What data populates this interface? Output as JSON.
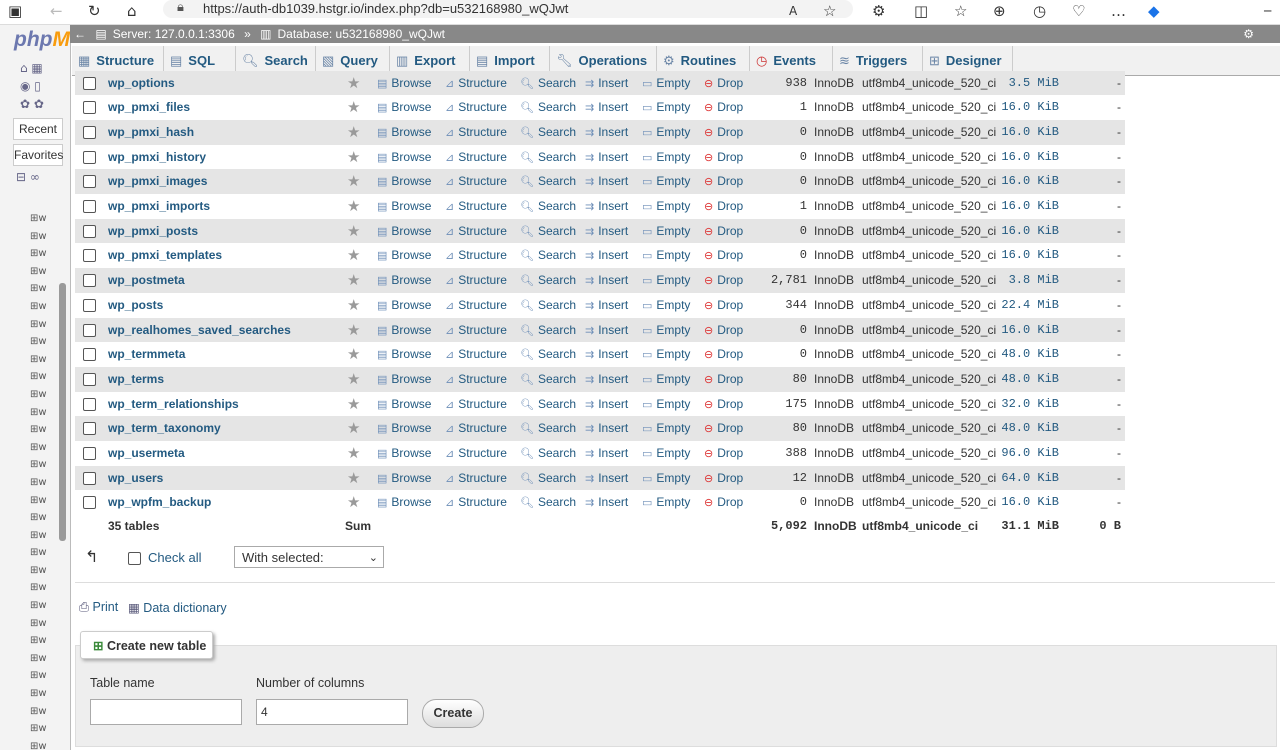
{
  "browser": {
    "url": "https://auth-db1039.hstgr.io/index.php?db=u532168980_wQJwt"
  },
  "breadcrumb": {
    "server": "Server: 127.0.0.1:3306",
    "separator": "»",
    "database": "Database: u532168980_wQJwt"
  },
  "tabs": [
    {
      "label": "Structure",
      "icon": "structure-icon"
    },
    {
      "label": "SQL",
      "icon": "sql-icon"
    },
    {
      "label": "Search",
      "icon": "search-icon"
    },
    {
      "label": "Query",
      "icon": "query-icon"
    },
    {
      "label": "Export",
      "icon": "export-icon"
    },
    {
      "label": "Import",
      "icon": "import-icon"
    },
    {
      "label": "Operations",
      "icon": "wrench-icon"
    },
    {
      "label": "Routines",
      "icon": "routines-icon"
    },
    {
      "label": "Events",
      "icon": "clock-icon"
    },
    {
      "label": "Triggers",
      "icon": "triggers-icon"
    },
    {
      "label": "Designer",
      "icon": "designer-icon"
    }
  ],
  "nav": {
    "logo_a": "php",
    "logo_b": "M",
    "recent": "Recent",
    "favorites": "Favorites",
    "tree_item": "w"
  },
  "actions": {
    "browse": "Browse",
    "structure": "Structure",
    "search": "Search",
    "insert": "Insert",
    "empty": "Empty",
    "drop": "Drop"
  },
  "tables": [
    {
      "name": "wp_options",
      "rows": "938",
      "engine": "InnoDB",
      "collation": "utf8mb4_unicode_520_ci",
      "size": "3.5 MiB",
      "overhead": "-"
    },
    {
      "name": "wp_pmxi_files",
      "rows": "1",
      "engine": "InnoDB",
      "collation": "utf8mb4_unicode_520_ci",
      "size": "16.0 KiB",
      "overhead": "-"
    },
    {
      "name": "wp_pmxi_hash",
      "rows": "0",
      "engine": "InnoDB",
      "collation": "utf8mb4_unicode_520_ci",
      "size": "16.0 KiB",
      "overhead": "-"
    },
    {
      "name": "wp_pmxi_history",
      "rows": "0",
      "engine": "InnoDB",
      "collation": "utf8mb4_unicode_520_ci",
      "size": "16.0 KiB",
      "overhead": "-"
    },
    {
      "name": "wp_pmxi_images",
      "rows": "0",
      "engine": "InnoDB",
      "collation": "utf8mb4_unicode_520_ci",
      "size": "16.0 KiB",
      "overhead": "-"
    },
    {
      "name": "wp_pmxi_imports",
      "rows": "1",
      "engine": "InnoDB",
      "collation": "utf8mb4_unicode_520_ci",
      "size": "16.0 KiB",
      "overhead": "-"
    },
    {
      "name": "wp_pmxi_posts",
      "rows": "0",
      "engine": "InnoDB",
      "collation": "utf8mb4_unicode_520_ci",
      "size": "16.0 KiB",
      "overhead": "-"
    },
    {
      "name": "wp_pmxi_templates",
      "rows": "0",
      "engine": "InnoDB",
      "collation": "utf8mb4_unicode_520_ci",
      "size": "16.0 KiB",
      "overhead": "-"
    },
    {
      "name": "wp_postmeta",
      "rows": "2,781",
      "engine": "InnoDB",
      "collation": "utf8mb4_unicode_520_ci",
      "size": "3.8 MiB",
      "overhead": "-"
    },
    {
      "name": "wp_posts",
      "rows": "344",
      "engine": "InnoDB",
      "collation": "utf8mb4_unicode_520_ci",
      "size": "22.4 MiB",
      "overhead": "-"
    },
    {
      "name": "wp_realhomes_saved_searches",
      "rows": "0",
      "engine": "InnoDB",
      "collation": "utf8mb4_unicode_520_ci",
      "size": "16.0 KiB",
      "overhead": "-"
    },
    {
      "name": "wp_termmeta",
      "rows": "0",
      "engine": "InnoDB",
      "collation": "utf8mb4_unicode_520_ci",
      "size": "48.0 KiB",
      "overhead": "-"
    },
    {
      "name": "wp_terms",
      "rows": "80",
      "engine": "InnoDB",
      "collation": "utf8mb4_unicode_520_ci",
      "size": "48.0 KiB",
      "overhead": "-"
    },
    {
      "name": "wp_term_relationships",
      "rows": "175",
      "engine": "InnoDB",
      "collation": "utf8mb4_unicode_520_ci",
      "size": "32.0 KiB",
      "overhead": "-"
    },
    {
      "name": "wp_term_taxonomy",
      "rows": "80",
      "engine": "InnoDB",
      "collation": "utf8mb4_unicode_520_ci",
      "size": "48.0 KiB",
      "overhead": "-"
    },
    {
      "name": "wp_usermeta",
      "rows": "388",
      "engine": "InnoDB",
      "collation": "utf8mb4_unicode_520_ci",
      "size": "96.0 KiB",
      "overhead": "-"
    },
    {
      "name": "wp_users",
      "rows": "12",
      "engine": "InnoDB",
      "collation": "utf8mb4_unicode_520_ci",
      "size": "64.0 KiB",
      "overhead": "-"
    },
    {
      "name": "wp_wpfm_backup",
      "rows": "0",
      "engine": "InnoDB",
      "collation": "utf8mb4_unicode_520_ci",
      "size": "16.0 KiB",
      "overhead": "-"
    }
  ],
  "summary": {
    "count": "35 tables",
    "label": "Sum",
    "rows": "5,092",
    "engine": "InnoDB",
    "collation": "utf8mb4_unicode_ci",
    "size": "31.1 MiB",
    "overhead": "0 B"
  },
  "bulk": {
    "check_all": "Check all",
    "with_selected": "With selected:"
  },
  "links": {
    "print": "Print",
    "data_dictionary": "Data dictionary"
  },
  "create_table": {
    "legend": "Create new table",
    "name_label": "Table name",
    "name_value": "",
    "columns_label": "Number of columns",
    "columns_value": "4",
    "button": "Create"
  }
}
